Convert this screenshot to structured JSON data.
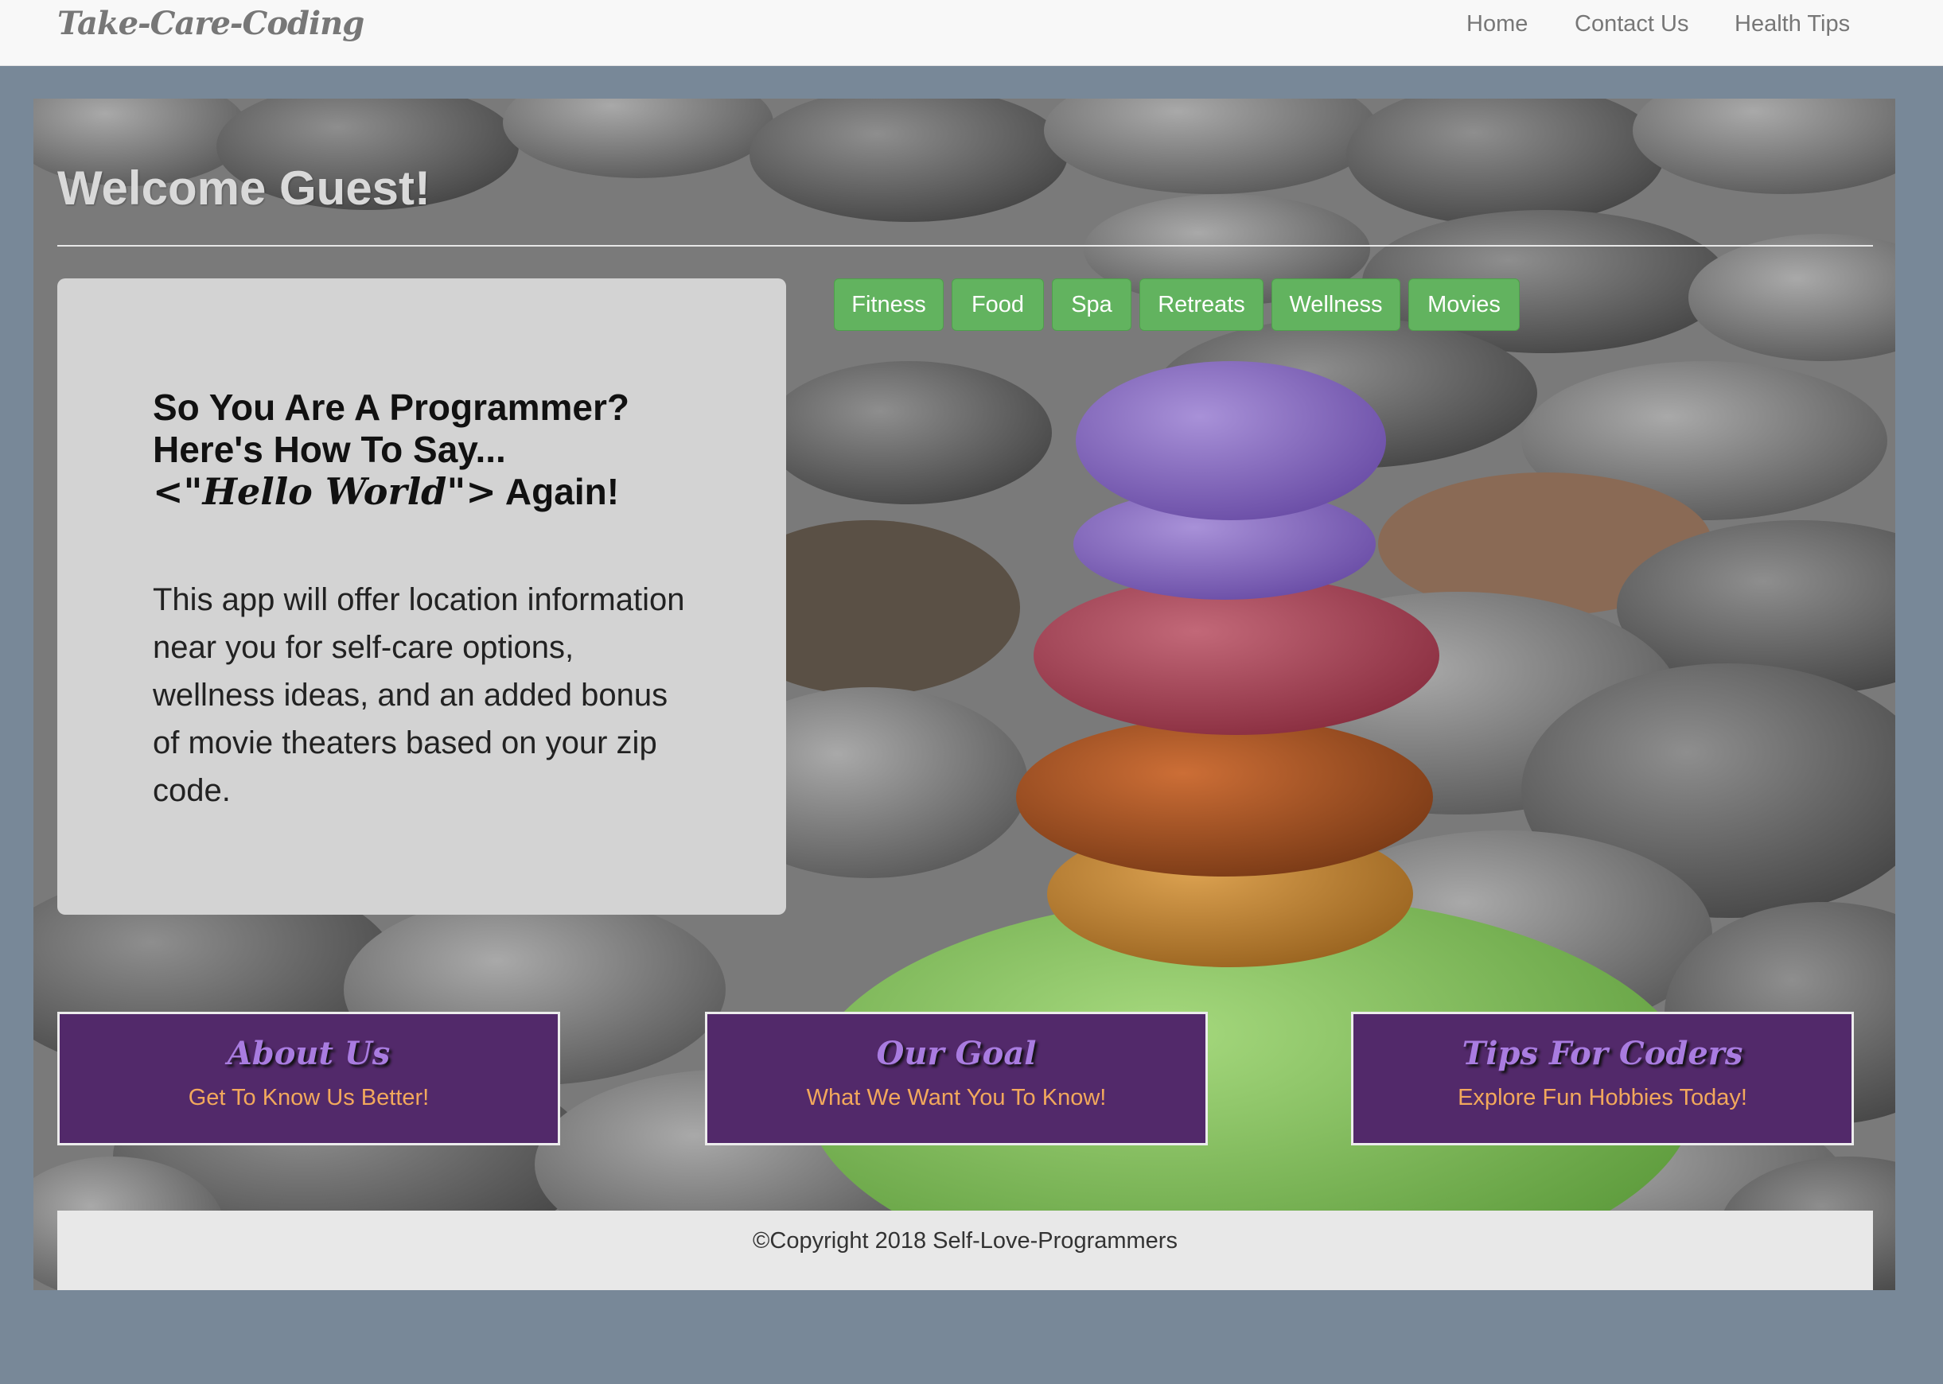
{
  "navbar": {
    "brand": "Take-Care-Coding",
    "links": [
      "Home",
      "Contact Us",
      "Health Tips"
    ]
  },
  "hero": {
    "welcome": "Welcome Guest!",
    "intro": {
      "title_line1": "So You Are A Programmer?",
      "title_line2": "Here's How To Say...",
      "hello": "<\"Hello World\">",
      "again": " Again!",
      "text": "This app will offer location information near you for self-care options, wellness ideas, and an added bonus of movie theaters based on your zip code."
    },
    "categories": [
      "Fitness",
      "Food",
      "Spa",
      "Retreats",
      "Wellness",
      "Movies"
    ]
  },
  "features": [
    {
      "title": "About Us",
      "subtitle": "Get To Know Us Better!"
    },
    {
      "title": "Our Goal",
      "subtitle": "What We Want You To Know!"
    },
    {
      "title": "Tips For Coders",
      "subtitle": "Explore Fun Hobbies Today!"
    }
  ],
  "footer": {
    "copyright": "©Copyright 2018 Self-Love-Programmers"
  },
  "colors": {
    "page_bg": "#788898",
    "button_green": "#62b35f",
    "feature_purple": "#52296a",
    "feature_title": "#a97ce0",
    "feature_subtitle": "#f2a85c"
  }
}
